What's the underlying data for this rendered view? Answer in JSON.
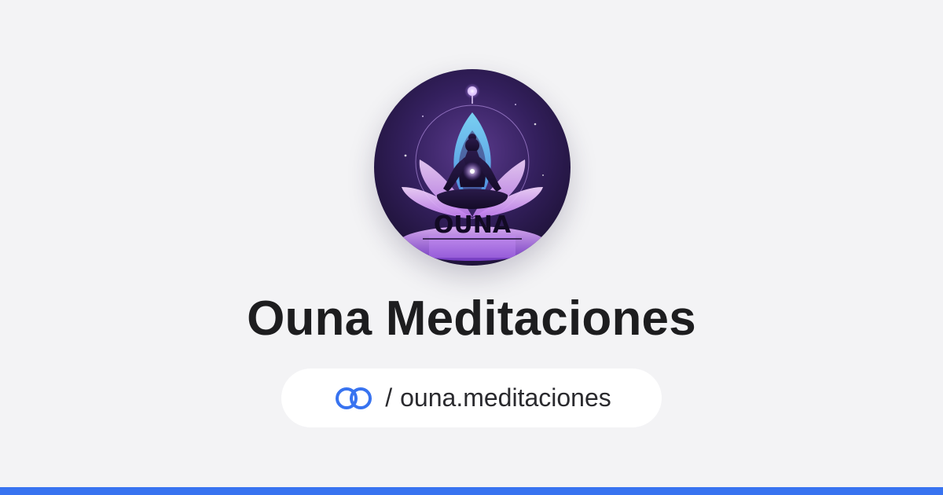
{
  "profile": {
    "logo_text": "OUNA",
    "name": "Ouna Meditaciones",
    "handle_separator": "/",
    "handle": "ouna.meditaciones"
  },
  "colors": {
    "background": "#f3f3f5",
    "accent_bar": "#3873f0",
    "link_icon": "#3873f0",
    "title_text": "#1d1d1f"
  },
  "icons": {
    "logo": "meditation-lotus-logo",
    "link": "linked-rings-icon"
  }
}
